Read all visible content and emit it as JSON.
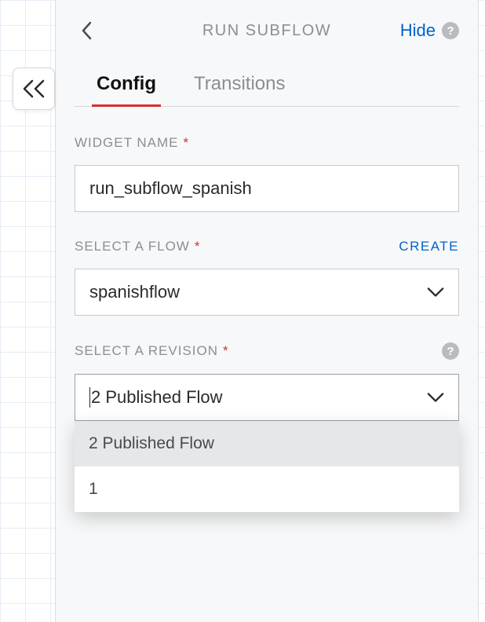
{
  "header": {
    "title": "RUN SUBFLOW",
    "hide_label": "Hide",
    "help_glyph": "?"
  },
  "tabs": {
    "config_label": "Config",
    "transitions_label": "Transitions"
  },
  "fields": {
    "widget_name": {
      "label": "WIDGET NAME",
      "value": "run_subflow_spanish"
    },
    "select_flow": {
      "label": "SELECT A FLOW",
      "create_label": "CREATE",
      "value": "spanishflow"
    },
    "select_revision": {
      "label": "SELECT A REVISION",
      "help_glyph": "?",
      "value": "2 Published Flow",
      "options": [
        "2 Published Flow",
        "1"
      ]
    }
  }
}
